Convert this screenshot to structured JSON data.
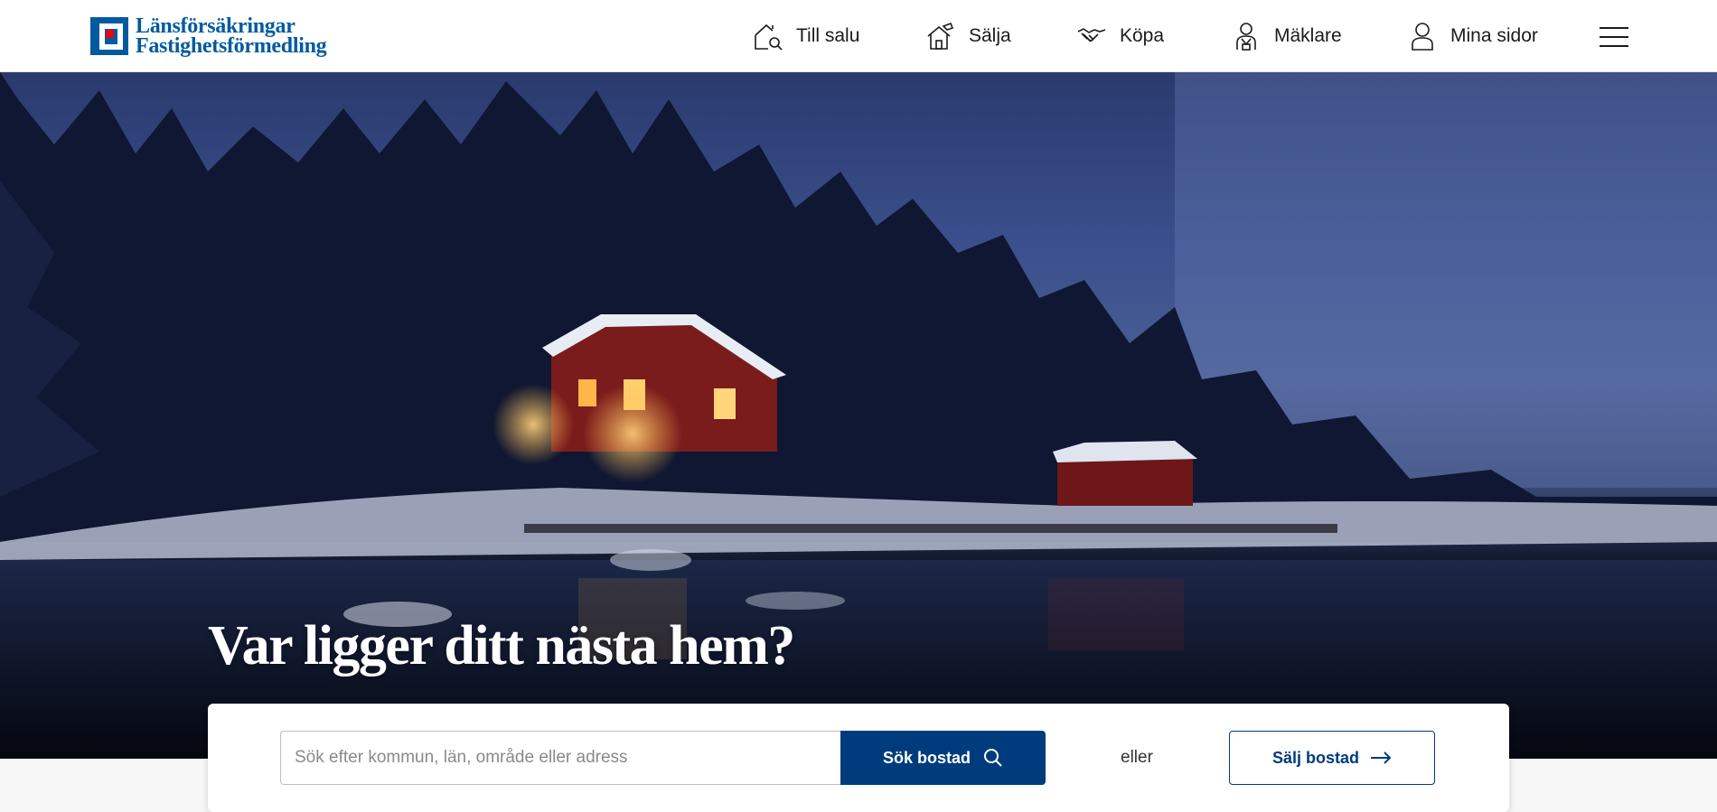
{
  "brand": {
    "line1": "Länsförsäkringar",
    "line2": "Fastighetsförmedling",
    "color": "#005aa0",
    "accent": "#e30613"
  },
  "nav": {
    "items": [
      {
        "label": "Till salu",
        "icon": "house-search-icon"
      },
      {
        "label": "Sälja",
        "icon": "house-sell-icon"
      },
      {
        "label": "Köpa",
        "icon": "handshake-icon"
      },
      {
        "label": "Mäklare",
        "icon": "agent-icon"
      },
      {
        "label": "Mina sidor",
        "icon": "user-icon"
      }
    ],
    "menu_icon": "hamburger-menu-icon"
  },
  "hero": {
    "title": "Var ligger ditt nästa hem?"
  },
  "search": {
    "placeholder": "Sök efter kommun, län, område eller adress",
    "value": "",
    "button_label": "Sök bostad",
    "or_label": "eller",
    "sell_label": "Sälj bostad",
    "button_color": "#003c7d"
  }
}
